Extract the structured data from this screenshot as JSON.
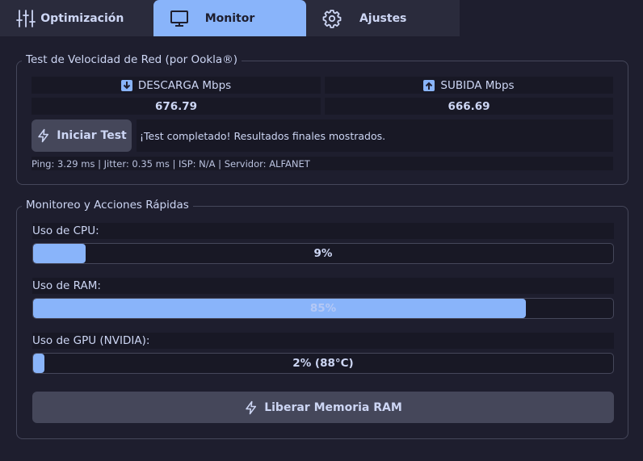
{
  "tabs": [
    {
      "label": "Optimización",
      "icon": "sliders-icon"
    },
    {
      "label": "Monitor",
      "icon": "monitor-icon",
      "active": true
    },
    {
      "label": "Ajustes",
      "icon": "gear-icon"
    }
  ],
  "speedtest": {
    "title": "Test de Velocidad de Red (por Ookla®)",
    "download_label": "DESCARGA Mbps",
    "upload_label": "SUBIDA Mbps",
    "download_value": "676.79",
    "upload_value": "666.69",
    "start_button": "Iniciar Test",
    "status": "¡Test completado! Resultados finales mostrados.",
    "info": "Ping: 3.29 ms | Jitter: 0.35 ms | ISP: N/A | Servidor: ALFANET"
  },
  "monitor": {
    "title": "Monitoreo y Acciones Rápidas",
    "cpu": {
      "label": "Uso de CPU:",
      "text": "9%",
      "percent": 9
    },
    "ram": {
      "label": "Uso de RAM:",
      "text": "85%",
      "percent": 85
    },
    "gpu": {
      "label": "Uso de GPU (NVIDIA):",
      "text": "2% (88°C)",
      "percent": 2
    },
    "free_ram_button": "Liberar Memoria RAM"
  },
  "colors": {
    "accent": "#89b4fa",
    "background": "#1e1e2e",
    "panel": "#181825",
    "border": "#45475a"
  }
}
